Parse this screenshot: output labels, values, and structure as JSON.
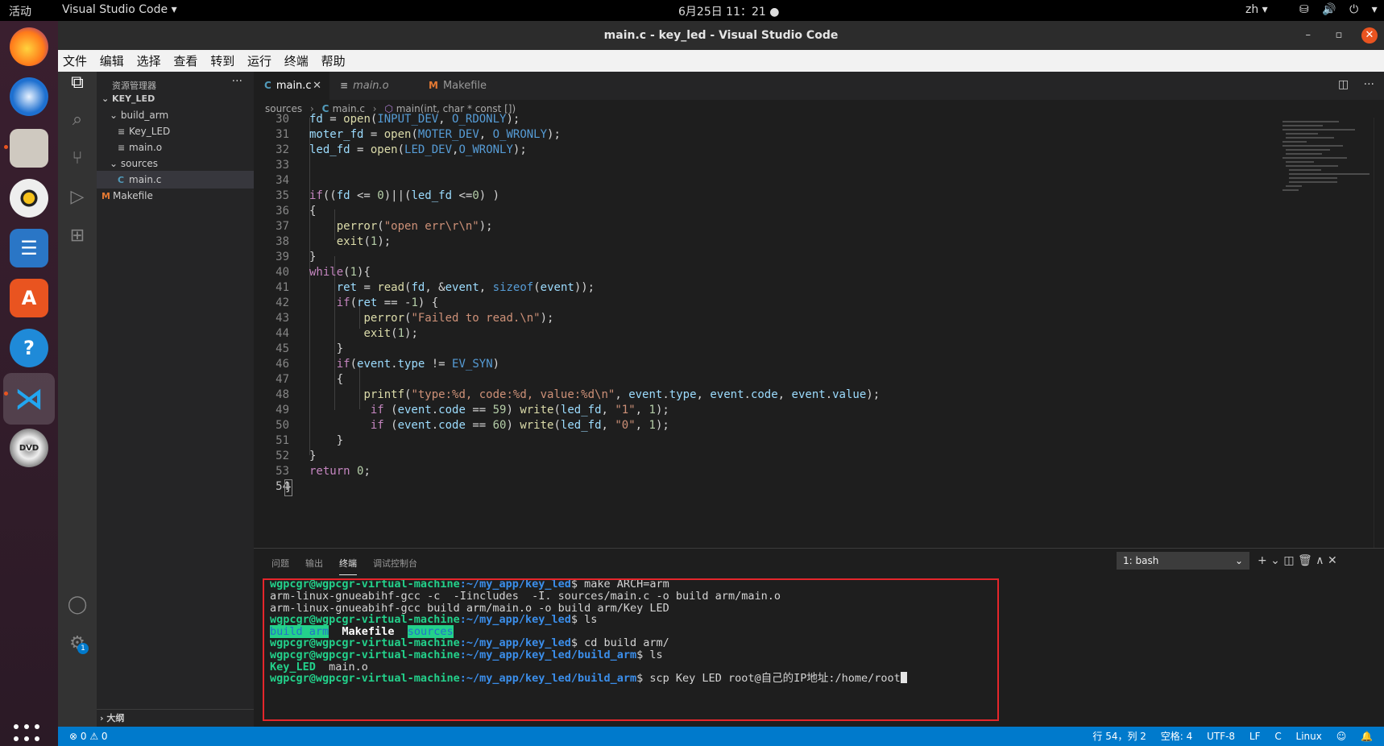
{
  "topbar": {
    "activities": "活动",
    "app_menu": "Visual Studio Code ▾",
    "clock": "6月25日  11：21  ●",
    "lang": "zh ▾",
    "tray": "⛁ 🔊 ⏻ ▾"
  },
  "window": {
    "title": "main.c - key_led - Visual Studio Code",
    "minimize": "–",
    "maximize": "▫",
    "close": "✕"
  },
  "menu": [
    "文件",
    "编辑",
    "选择",
    "查看",
    "转到",
    "运行",
    "终端",
    "帮助"
  ],
  "explorer": {
    "header": "资源管理器",
    "more": "···",
    "root": "KEY_LED",
    "folder_build": "build_arm",
    "file_keyled": "Key_LED",
    "file_maino": "main.o",
    "folder_sources": "sources",
    "file_mainc": "main.c",
    "file_makefile": "Makefile",
    "outline": "大纲"
  },
  "tabs": {
    "tab1": "main.c",
    "tab2": "main.o",
    "tab3": "Makefile",
    "close": "✕"
  },
  "breadcrumb": {
    "folder": "sources",
    "file": "main.c",
    "symbol": "main(int, char * const [])"
  },
  "line_numbers": [
    "30",
    "31",
    "32",
    "33",
    "34",
    "35",
    "36",
    "37",
    "38",
    "39",
    "40",
    "41",
    "42",
    "43",
    "44",
    "45",
    "46",
    "47",
    "48",
    "49",
    "50",
    "51",
    "52",
    "53",
    "54"
  ],
  "code_lines": [
    "fd = open(INPUT_DEV, O_RDONLY);",
    "moter_fd = open(MOTER_DEV, O_WRONLY);",
    "led_fd = open(LED_DEV,O_WRONLY);",
    "",
    "",
    "if((fd <= 0)||(led_fd <=0) )",
    "{",
    "    perror(\"open err\\r\\n\");",
    "    exit(1);",
    "}",
    "while(1){",
    "    ret = read(fd, &event, sizeof(event));",
    "    if(ret == -1) {",
    "        perror(\"Failed to read.\\n\");",
    "        exit(1);",
    "    }",
    "    if(event.type != EV_SYN)",
    "    {",
    "        printf(\"type:%d, code:%d, value:%d\\n\", event.type, event.code, event.value);",
    "         if (event.code == 59) write(led_fd, \"1\", 1);",
    "         if (event.code == 60) write(led_fd, \"0\", 1);",
    "    }",
    "}",
    "return 0;",
    "}"
  ],
  "panel": {
    "tabs": [
      "问题",
      "输出",
      "终端",
      "调试控制台"
    ],
    "terminal_select": "1: bash",
    "actions": "+ ⌄ ◫ 🗑 ∧ ✕"
  },
  "terminal": {
    "prompt_user": "wgpcgr@wgpcgr-virtual-machine",
    "lines": [
      {
        "path": ":~/my_app/key_led",
        "cmd": "$ make ARCH=arm"
      },
      {
        "out": "arm-linux-gnueabihf-gcc -c  -Iincludes  -I. sources/main.c -o build arm/main.o"
      },
      {
        "out": "arm-linux-gnueabihf-gcc build arm/main.o -o build arm/Key LED"
      },
      {
        "path": ":~/my_app/key_led",
        "cmd": "$ ls"
      },
      {
        "ls1": "build arm",
        "ls2": "Makefile",
        "ls3": "sources"
      },
      {
        "path": ":~/my_app/key_led",
        "cmd": "$ cd build arm/"
      },
      {
        "path": ":~/my_app/key_led/build_arm",
        "cmd": "$ ls"
      },
      {
        "ls1": "Key_LED",
        "ls2": "main.o"
      },
      {
        "path": ":~/my_app/key_led/build_arm",
        "cmd": "$ scp Key LED root@自己的IP地址:/home/root"
      }
    ]
  },
  "status": {
    "problems": "⊗ 0 ⚠ 0",
    "position": "行 54，列 2",
    "spaces": "空格: 4",
    "encoding": "UTF-8",
    "eol": "LF",
    "lang": "C",
    "os": "Linux"
  },
  "colors": {
    "accent": "#007acc",
    "highlight_box": "#e5262b",
    "terminal_prompt": "#23d18b",
    "terminal_path": "#3b8eea"
  }
}
